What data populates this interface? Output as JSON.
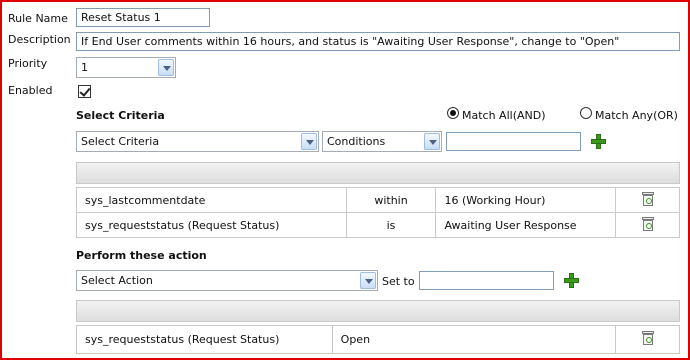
{
  "form": {
    "rule_name_label": "Rule Name",
    "rule_name_value": "Reset Status 1",
    "description_label": "Description",
    "description_value": "If End User comments within 16 hours, and status is \"Awaiting User Response\", change to \"Open\"",
    "priority_label": "Priority",
    "priority_value": "1",
    "enabled_label": "Enabled",
    "enabled_checked": true
  },
  "criteria": {
    "title": "Select Criteria",
    "match_all_label": "Match All(AND)",
    "match_any_label": "Match Any(OR)",
    "selected_match": "all",
    "criteria_select_value": "Select Criteria",
    "conditions_select_value": "Conditions",
    "value_input": "",
    "rows": [
      {
        "field": "sys_lastcommentdate",
        "operator": "within",
        "value": "16 (Working Hour)"
      },
      {
        "field": "sys_requeststatus (Request Status)",
        "operator": "is",
        "value": "Awaiting User Response"
      }
    ]
  },
  "actions": {
    "title": "Perform these action",
    "action_select_value": "Select Action",
    "set_to_label": "Set to",
    "set_to_input": "",
    "rows": [
      {
        "field": "sys_requeststatus (Request Status)",
        "value": "Open"
      }
    ]
  },
  "icons": {
    "add": "plus-icon",
    "delete": "trash-icon",
    "accent": "#3b9a1e",
    "frame_border": "#e00000"
  }
}
